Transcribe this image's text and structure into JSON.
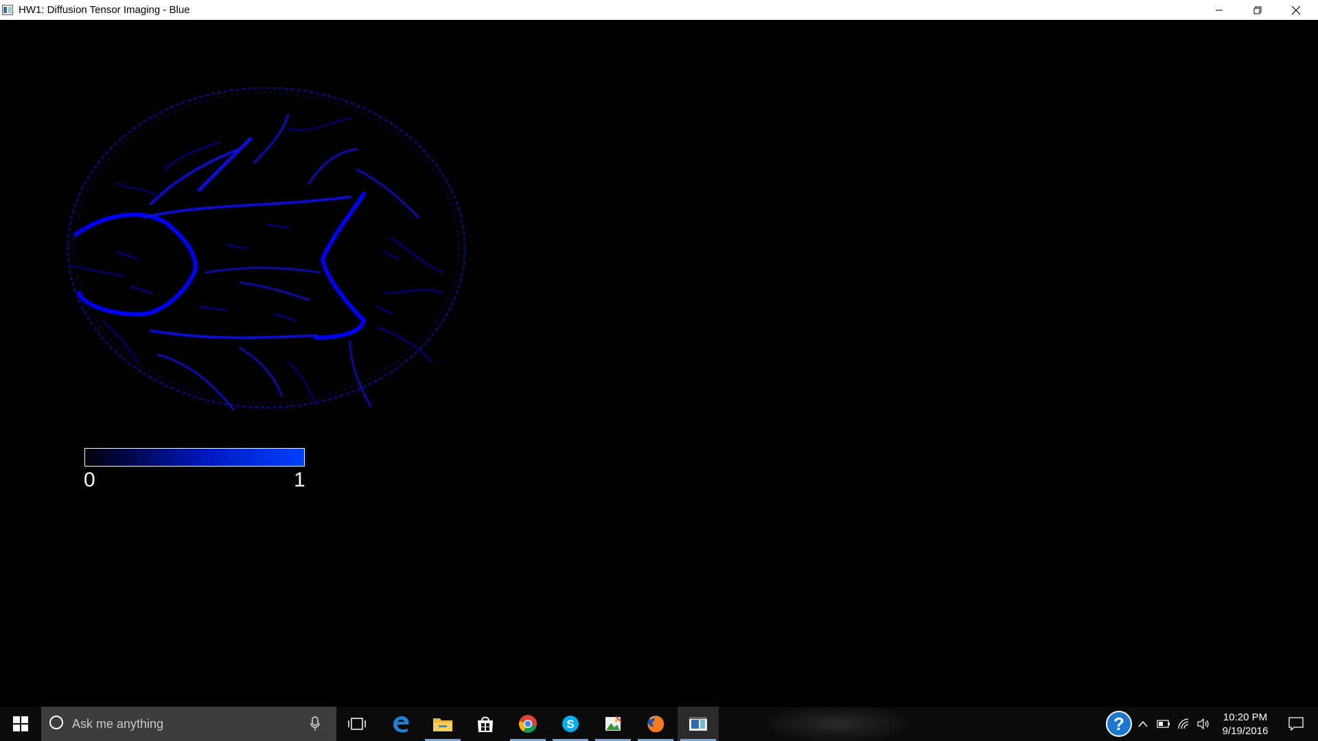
{
  "window": {
    "title": "HW1: Diffusion Tensor Imaging - Blue",
    "controls": [
      "minimize",
      "restore",
      "close"
    ]
  },
  "visualization": {
    "image": "axial brain slice (blue channel)",
    "colorbar": {
      "min_label": "0",
      "max_label": "1",
      "color_start": "#000008",
      "color_end": "#0040ff"
    }
  },
  "taskbar": {
    "search_placeholder": "Ask me anything",
    "pinned": [
      {
        "name": "task-view",
        "icon": "task-view-icon"
      },
      {
        "name": "edge",
        "icon": "edge-icon"
      },
      {
        "name": "file-explorer",
        "icon": "folder-icon",
        "running": true
      },
      {
        "name": "store",
        "icon": "store-icon"
      },
      {
        "name": "chrome",
        "icon": "chrome-icon",
        "running": true
      },
      {
        "name": "skype",
        "icon": "skype-icon",
        "running": true
      },
      {
        "name": "image-app",
        "icon": "image-icon",
        "running": true
      },
      {
        "name": "firefox",
        "icon": "firefox-icon",
        "running": true
      },
      {
        "name": "hw1-app",
        "icon": "app-window-icon",
        "running": true,
        "active": true
      }
    ],
    "tray": {
      "icons": [
        "help-icon",
        "chevron-up-icon",
        "battery-icon",
        "wifi-icon",
        "volume-icon"
      ],
      "time": "10:20 PM",
      "date": "9/19/2016"
    },
    "accent": "#7aa7d9"
  }
}
